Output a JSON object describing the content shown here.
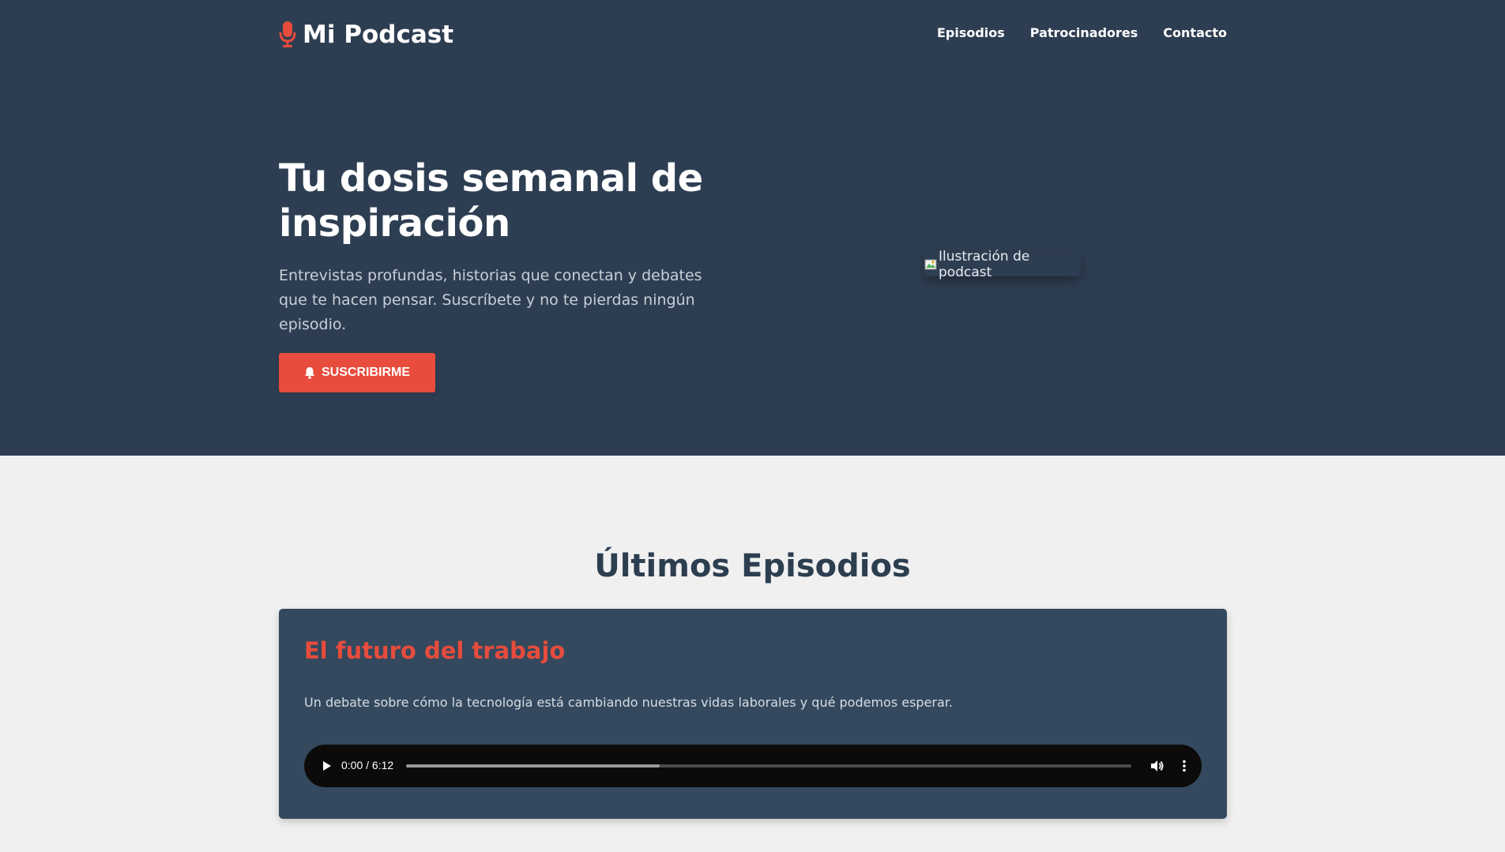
{
  "header": {
    "brand": "Mi Podcast",
    "brand_icon": "microphone-icon",
    "nav": [
      {
        "label": "Episodios"
      },
      {
        "label": "Patrocinadores"
      },
      {
        "label": "Contacto"
      }
    ]
  },
  "hero": {
    "title": "Tu dosis semanal de inspiración",
    "description": "Entrevistas profundas, historias que conectan y debates que te hacen pensar. Suscríbete y no te pierdas ningún episodio.",
    "cta_label": "SUSCRIBIRME",
    "cta_icon": "bell-icon",
    "image_alt": "Ilustración de podcast"
  },
  "episodes_section": {
    "title": "Últimos Episodios",
    "episodes": [
      {
        "title": "El futuro del trabajo",
        "description": "Un debate sobre cómo la tecnología está cambiando nuestras vidas laborales y qué podemos esperar.",
        "player": {
          "time": "0:00 / 6:12",
          "buffered_fraction": 0.35
        }
      }
    ]
  },
  "colors": {
    "hero_bg": "#2e3e52",
    "accent": "#e74c3c",
    "card_bg": "#34495e",
    "page_bg": "#f0f0f0",
    "heading": "#2c3e50"
  }
}
